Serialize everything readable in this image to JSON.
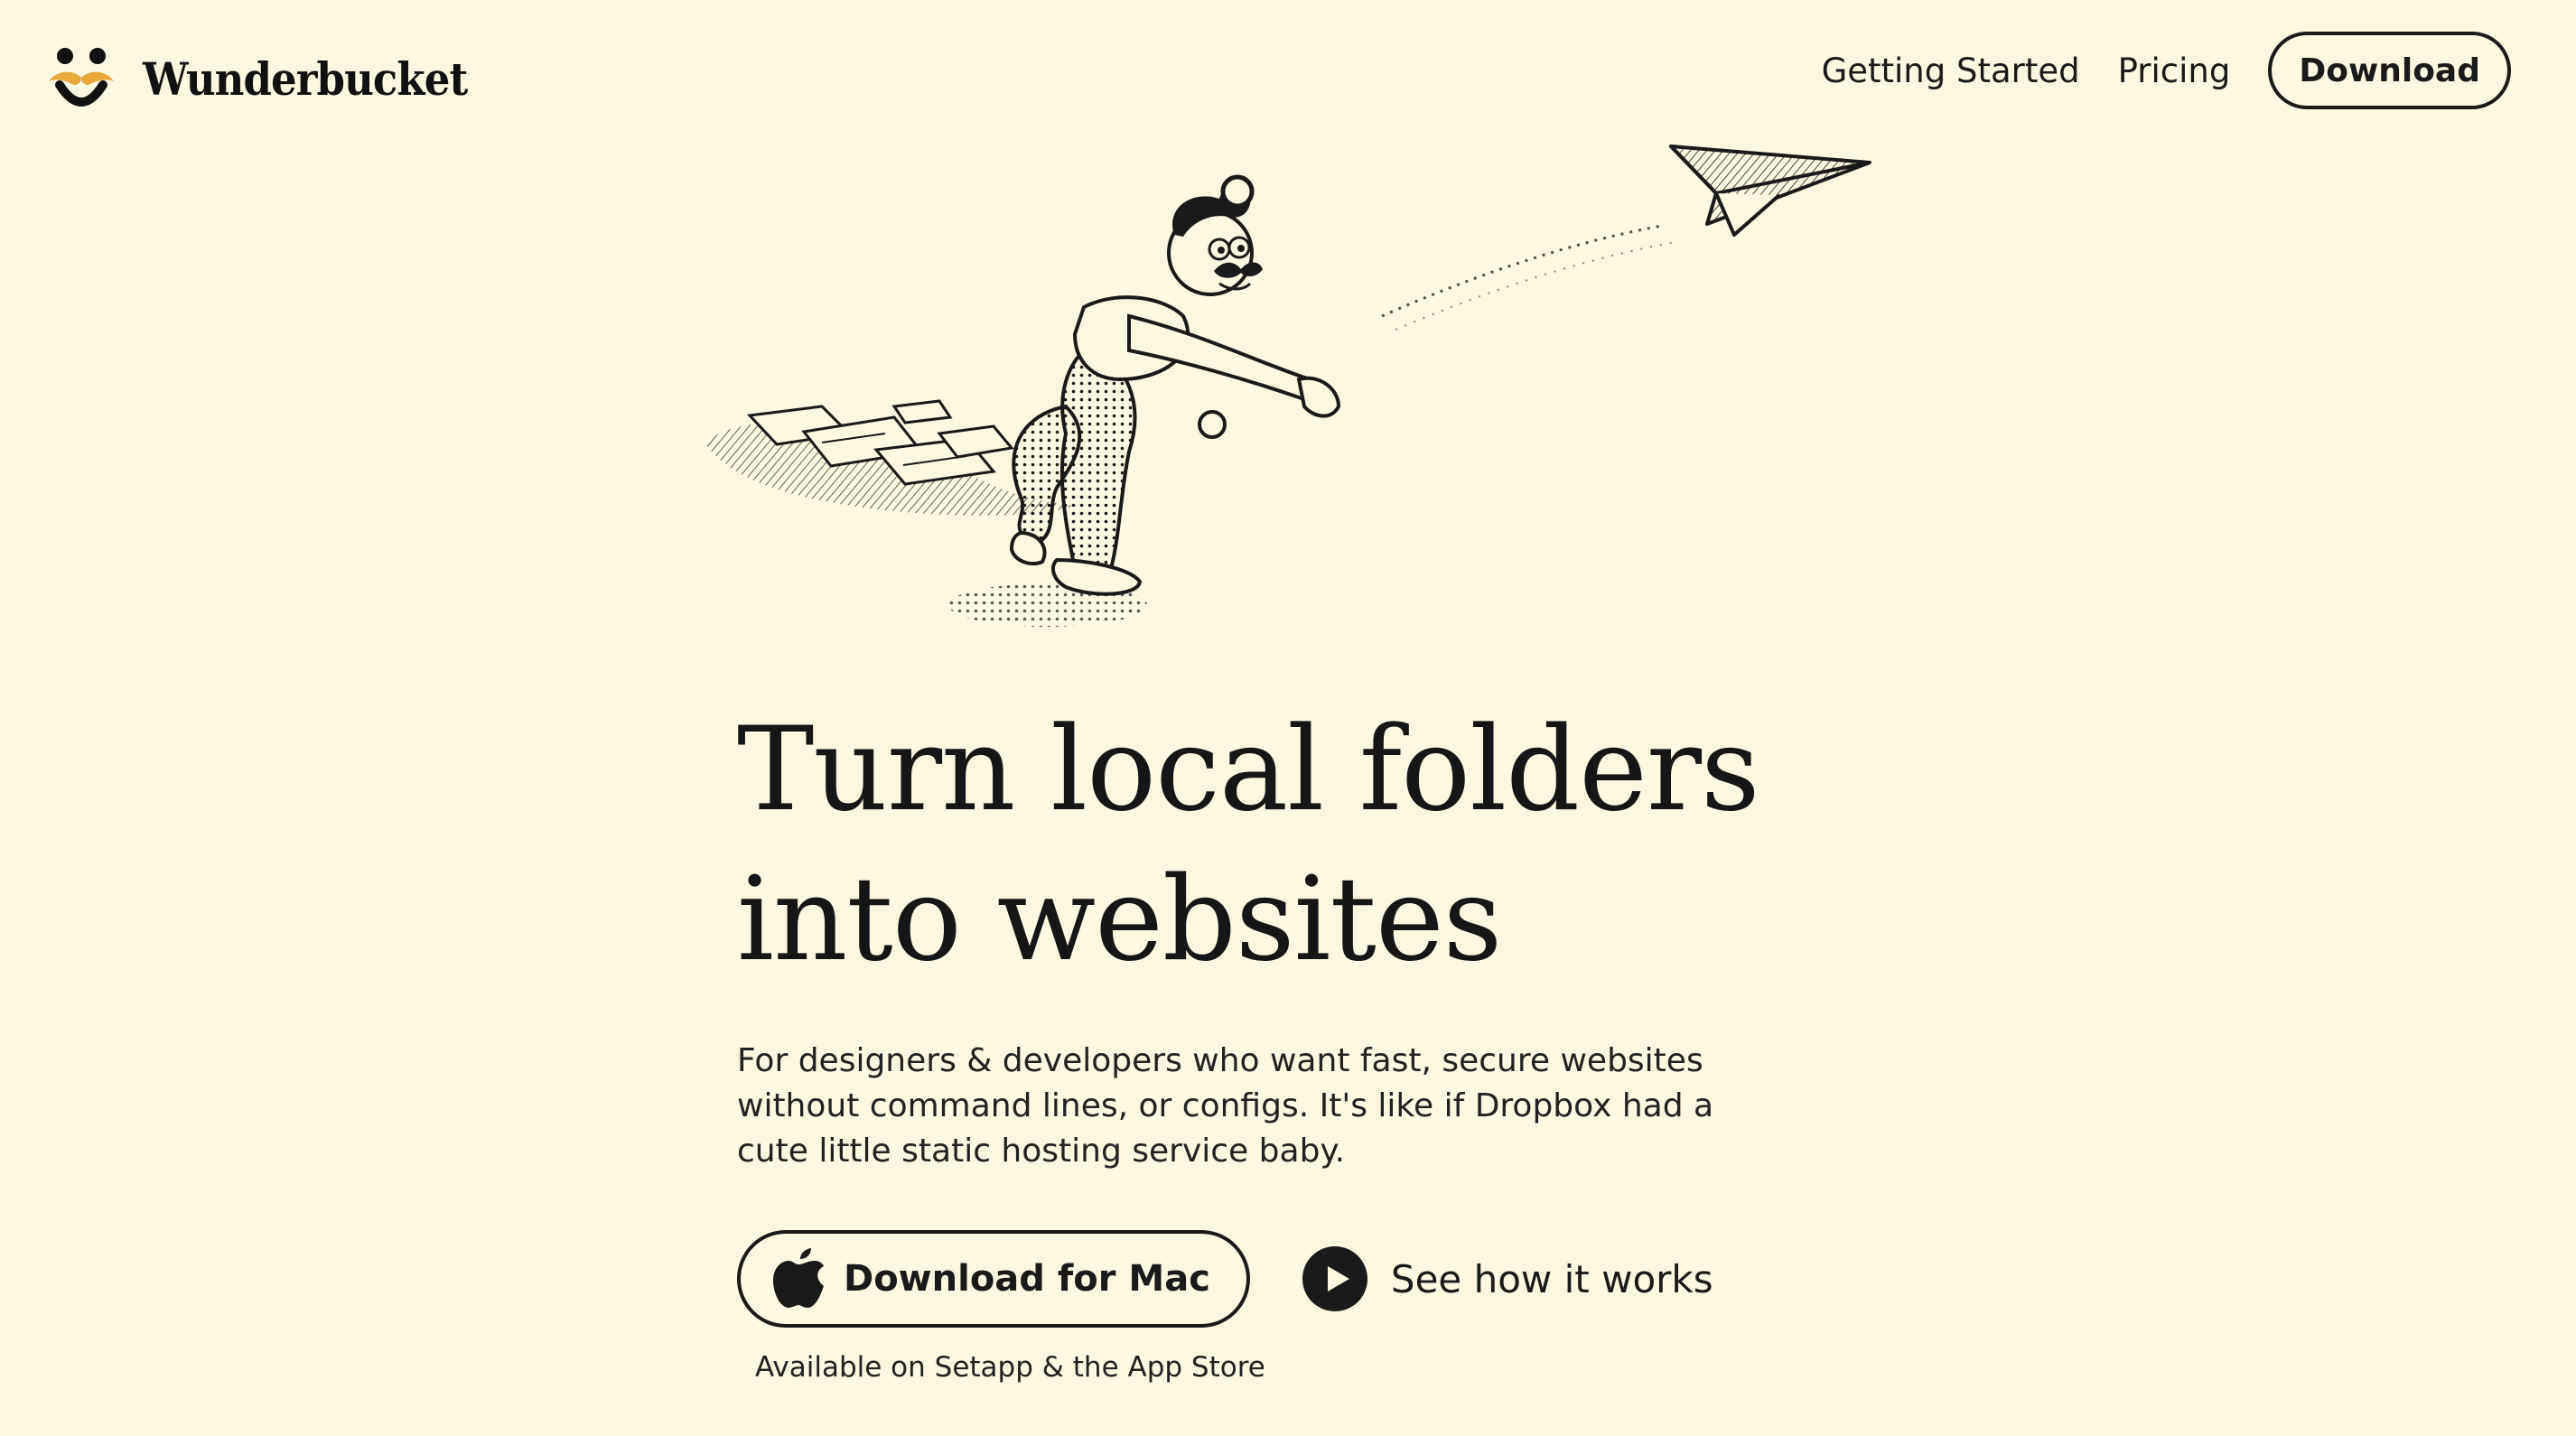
{
  "header": {
    "brand": "Wunderbucket",
    "nav": {
      "getting_started": "Getting Started",
      "pricing": "Pricing",
      "download": "Download"
    }
  },
  "hero": {
    "title_line1": "Turn local folders",
    "title_line2": "into websites",
    "description": "For designers & developers who want fast, secure websites without command lines, or configs. It's like if Dropbox had a cute little static hosting service baby.",
    "cta_primary": "Download for Mac",
    "cta_secondary": "See how it works",
    "availability": "Available on Setapp & the App Store"
  },
  "icons": {
    "logo": "smiley-mustache-icon",
    "primary_cta": "apple-icon",
    "secondary_cta": "play-icon"
  },
  "colors": {
    "background": "#fbf7e1",
    "text": "#1a1a1a",
    "mustache": "#e8a93a"
  }
}
